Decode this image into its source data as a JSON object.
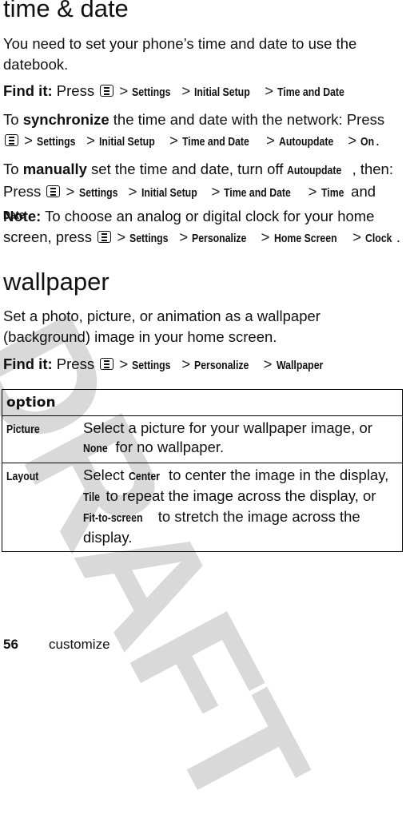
{
  "watermark": "DRAFT",
  "time_date": {
    "title": "time & date",
    "intro": "You need to set your phone’s time and date to use the datebook.",
    "find_it": {
      "label": "Find it:",
      "press": "Press",
      "path": [
        "Settings",
        "Initial Setup",
        "Time and Date"
      ]
    },
    "synchronize": {
      "pre": "To",
      "keyword": "synchronize",
      "text": "the time and date with the network: Press",
      "path": [
        "Settings",
        "Initial Setup",
        "Time and Date",
        "Autoupdate",
        "On"
      ]
    },
    "manually": {
      "pre": "To",
      "keyword": "manually",
      "text": "set the time and date, turn off",
      "autoupdate": "Autoupdate",
      "then": ", then: Press",
      "path": [
        "Settings",
        "Initial Setup",
        "Time and Date",
        "Time"
      ],
      "and": "and",
      "last": "Date"
    },
    "note": {
      "label": "Note:",
      "text": "To choose an analog or digital clock for your home screen, press",
      "path": [
        "Settings",
        "Personalize",
        "Home Screen",
        "Clock"
      ]
    }
  },
  "wallpaper": {
    "title": "wallpaper",
    "intro": "Set a photo, picture, or animation as a wallpaper (background) image in your home screen.",
    "find_it": {
      "label": "Find it:",
      "press": "Press",
      "path": [
        "Settings",
        "Personalize",
        "Wallpaper"
      ]
    },
    "table": {
      "header": "option",
      "rows": [
        {
          "name": "Picture",
          "desc_pre": "Select a picture for your wallpaper image, or",
          "none": "None",
          "desc_post": "for no wallpaper."
        },
        {
          "name": "Layout",
          "select": "Select",
          "center": "Center",
          "center_text": "to center the image in the display,",
          "tile": "Tile",
          "tile_text": "to repeat the image across the display, or",
          "fit": "Fit-to-screen",
          "fit_text": "to stretch the image across the display."
        }
      ]
    }
  },
  "footer": {
    "page_number": "56",
    "section": "customize"
  },
  "icons": {
    "menu_key": "menu-key-icon",
    "separator": ">"
  }
}
